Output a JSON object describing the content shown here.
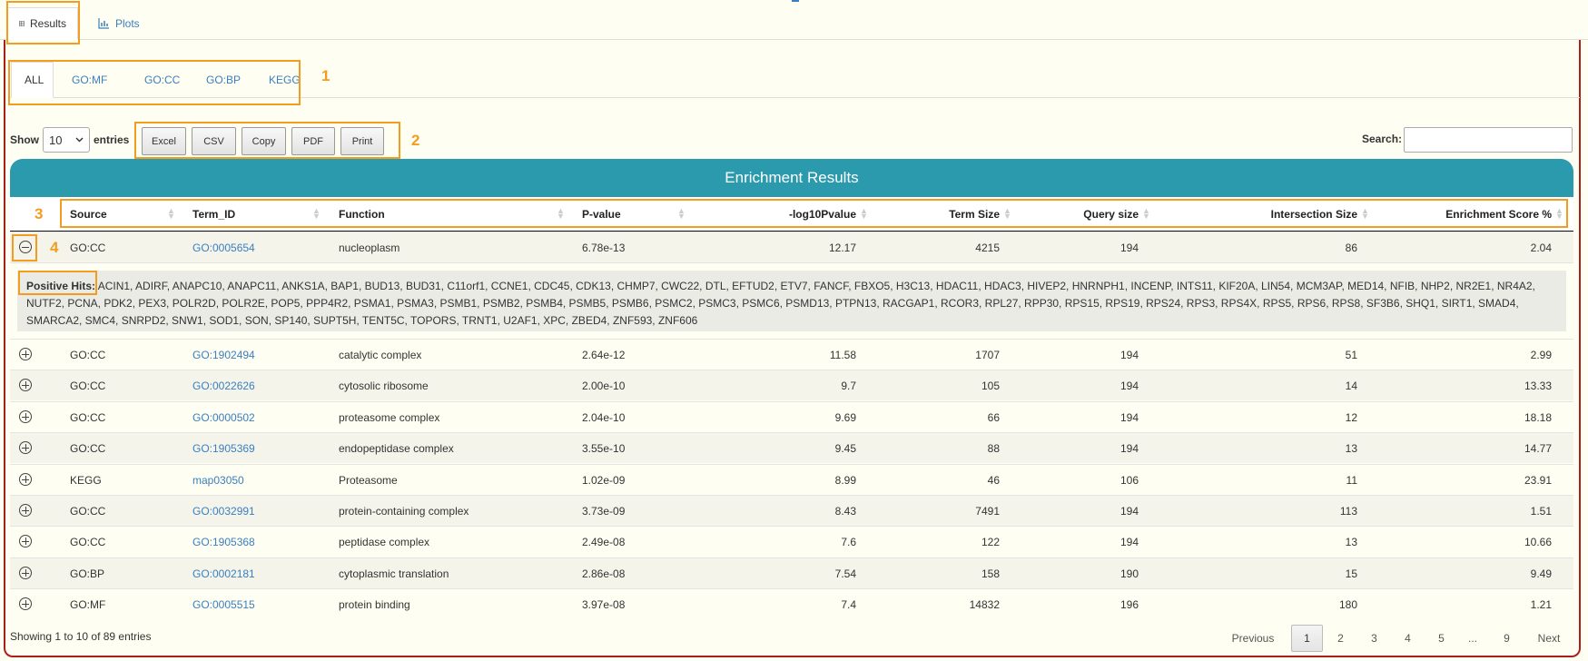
{
  "main_tabs": [
    {
      "label": "Results",
      "icon": "table-icon",
      "active": true
    },
    {
      "label": "Plots",
      "icon": "chart-icon",
      "active": false
    }
  ],
  "sub_tabs": [
    "ALL",
    "GO:MF",
    "GO:CC",
    "GO:BP",
    "KEGG"
  ],
  "annotations": [
    "1",
    "2",
    "3",
    "4"
  ],
  "controls": {
    "show_label": "Show",
    "entries_value": "10",
    "entries_label": "entries",
    "buttons": [
      "Excel",
      "CSV",
      "Copy",
      "PDF",
      "Print"
    ],
    "search_label": "Search:",
    "search_value": ""
  },
  "table": {
    "title": "Enrichment Results",
    "columns": [
      "Source",
      "Term_ID",
      "Function",
      "P-value",
      "-log10Pvalue",
      "Term Size",
      "Query size",
      "Intersection Size",
      "Enrichment Score %"
    ],
    "rows": [
      {
        "source": "GO:CC",
        "term_id": "GO:0005654",
        "function": "nucleoplasm",
        "pvalue": "6.78e-13",
        "log10p": "12.17",
        "term_size": "4215",
        "query_size": "194",
        "intersection": "86",
        "score": "2.04",
        "expanded": true
      },
      {
        "source": "GO:CC",
        "term_id": "GO:1902494",
        "function": "catalytic complex",
        "pvalue": "2.64e-12",
        "log10p": "11.58",
        "term_size": "1707",
        "query_size": "194",
        "intersection": "51",
        "score": "2.99",
        "expanded": false
      },
      {
        "source": "GO:CC",
        "term_id": "GO:0022626",
        "function": "cytosolic ribosome",
        "pvalue": "2.00e-10",
        "log10p": "9.7",
        "term_size": "105",
        "query_size": "194",
        "intersection": "14",
        "score": "13.33",
        "expanded": false
      },
      {
        "source": "GO:CC",
        "term_id": "GO:0000502",
        "function": "proteasome complex",
        "pvalue": "2.04e-10",
        "log10p": "9.69",
        "term_size": "66",
        "query_size": "194",
        "intersection": "12",
        "score": "18.18",
        "expanded": false
      },
      {
        "source": "GO:CC",
        "term_id": "GO:1905369",
        "function": "endopeptidase complex",
        "pvalue": "3.55e-10",
        "log10p": "9.45",
        "term_size": "88",
        "query_size": "194",
        "intersection": "13",
        "score": "14.77",
        "expanded": false
      },
      {
        "source": "KEGG",
        "term_id": "map03050",
        "function": "Proteasome",
        "pvalue": "1.02e-09",
        "log10p": "8.99",
        "term_size": "46",
        "query_size": "106",
        "intersection": "11",
        "score": "23.91",
        "expanded": false
      },
      {
        "source": "GO:CC",
        "term_id": "GO:0032991",
        "function": "protein-containing complex",
        "pvalue": "3.73e-09",
        "log10p": "8.43",
        "term_size": "7491",
        "query_size": "194",
        "intersection": "113",
        "score": "1.51",
        "expanded": false
      },
      {
        "source": "GO:CC",
        "term_id": "GO:1905368",
        "function": "peptidase complex",
        "pvalue": "2.49e-08",
        "log10p": "7.6",
        "term_size": "122",
        "query_size": "194",
        "intersection": "13",
        "score": "10.66",
        "expanded": false
      },
      {
        "source": "GO:BP",
        "term_id": "GO:0002181",
        "function": "cytoplasmic translation",
        "pvalue": "2.86e-08",
        "log10p": "7.54",
        "term_size": "158",
        "query_size": "190",
        "intersection": "15",
        "score": "9.49",
        "expanded": false
      },
      {
        "source": "GO:MF",
        "term_id": "GO:0005515",
        "function": "protein binding",
        "pvalue": "3.97e-08",
        "log10p": "7.4",
        "term_size": "14832",
        "query_size": "196",
        "intersection": "180",
        "score": "1.21",
        "expanded": false
      }
    ],
    "positive_hits_label": "Positive Hits:",
    "positive_hits": "ACIN1, ADIRF, ANAPC10, ANAPC11, ANKS1A, BAP1, BUD13, BUD31, C11orf1, CCNE1, CDC45, CDK13, CHMP7, CWC22, DTL, EFTUD2, ETV7, FANCF, FBXO5, H3C13, HDAC11, HDAC3, HIVEP2, HNRNPH1, INCENP, INTS11, KIF20A, LIN54, MCM3AP, MED14, NFIB, NHP2, NR2E1, NR4A2, NUTF2, PCNA, PDK2, PEX3, POLR2D, POLR2E, POP5, PPP4R2, PSMA1, PSMA3, PSMB1, PSMB2, PSMB4, PSMB5, PSMB6, PSMC2, PSMC3, PSMC6, PSMD13, PTPN13, RACGAP1, RCOR3, RPL27, RPP30, RPS15, RPS19, RPS24, RPS3, RPS4X, RPS5, RPS6, RPS8, SF3B6, SHQ1, SIRT1, SMAD4, SMARCA2, SMC4, SNRPD2, SNW1, SOD1, SON, SP140, SUPT5H, TENT5C, TOPORS, TRNT1, U2AF1, XPC, ZBED4, ZNF593, ZNF606"
  },
  "footer": {
    "info": "Showing 1 to 10 of 89 entries",
    "previous": "Previous",
    "pages": [
      "1",
      "2",
      "3",
      "4",
      "5",
      "...",
      "9"
    ],
    "next": "Next",
    "current_page": "1"
  }
}
